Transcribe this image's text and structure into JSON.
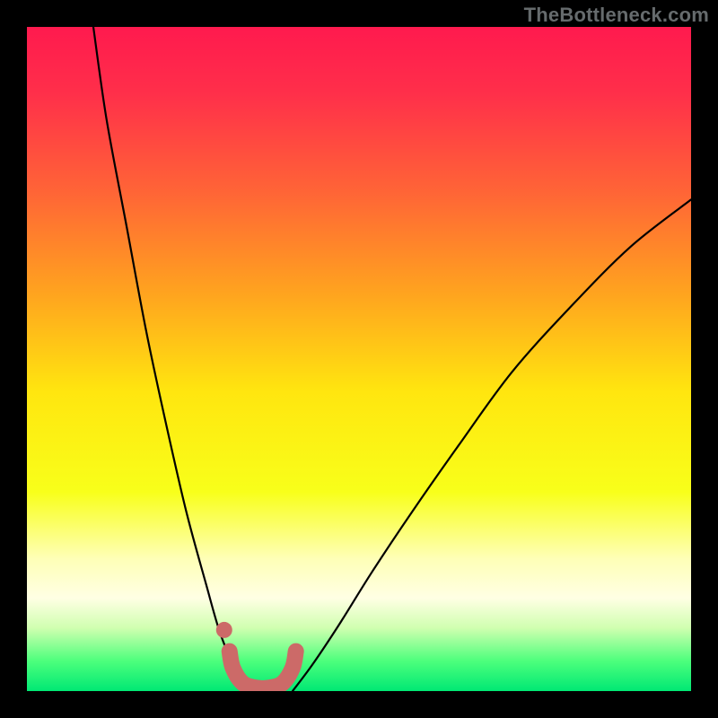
{
  "watermark": "TheBottleneck.com",
  "chart_data": {
    "type": "line",
    "title": "",
    "xlabel": "",
    "ylabel": "",
    "xlim": [
      0,
      100
    ],
    "ylim": [
      0,
      100
    ],
    "grid": false,
    "series": [
      {
        "name": "curve-left",
        "x": [
          10,
          12,
          15,
          18,
          21,
          24,
          27,
          29,
          31,
          33
        ],
        "values": [
          100,
          86,
          70,
          54,
          40,
          27,
          16,
          9,
          4,
          0
        ]
      },
      {
        "name": "curve-right",
        "x": [
          40,
          43,
          47,
          52,
          58,
          65,
          73,
          82,
          91,
          100
        ],
        "values": [
          0,
          4,
          10,
          18,
          27,
          37,
          48,
          58,
          67,
          74
        ]
      },
      {
        "name": "highlight-segment",
        "x": [
          30.5,
          31,
          32.5,
          34.5,
          36.5,
          38.5,
          40,
          40.5
        ],
        "values": [
          6,
          3.5,
          1.2,
          0.5,
          0.5,
          1.2,
          3.5,
          6
        ]
      },
      {
        "name": "highlight-dot",
        "x": [
          29.7
        ],
        "values": [
          9.2
        ]
      }
    ],
    "gradient_stops": [
      {
        "offset": 0.0,
        "color": "#ff1a4e"
      },
      {
        "offset": 0.1,
        "color": "#ff2f4a"
      },
      {
        "offset": 0.25,
        "color": "#ff6536"
      },
      {
        "offset": 0.4,
        "color": "#ffa31f"
      },
      {
        "offset": 0.55,
        "color": "#ffe60f"
      },
      {
        "offset": 0.7,
        "color": "#f8ff1a"
      },
      {
        "offset": 0.8,
        "color": "#feffb6"
      },
      {
        "offset": 0.86,
        "color": "#ffffe4"
      },
      {
        "offset": 0.905,
        "color": "#d0ffb0"
      },
      {
        "offset": 0.955,
        "color": "#4cff7c"
      },
      {
        "offset": 1.0,
        "color": "#00e874"
      }
    ],
    "line_color": "#000000",
    "highlight_color": "#cc6a68"
  }
}
